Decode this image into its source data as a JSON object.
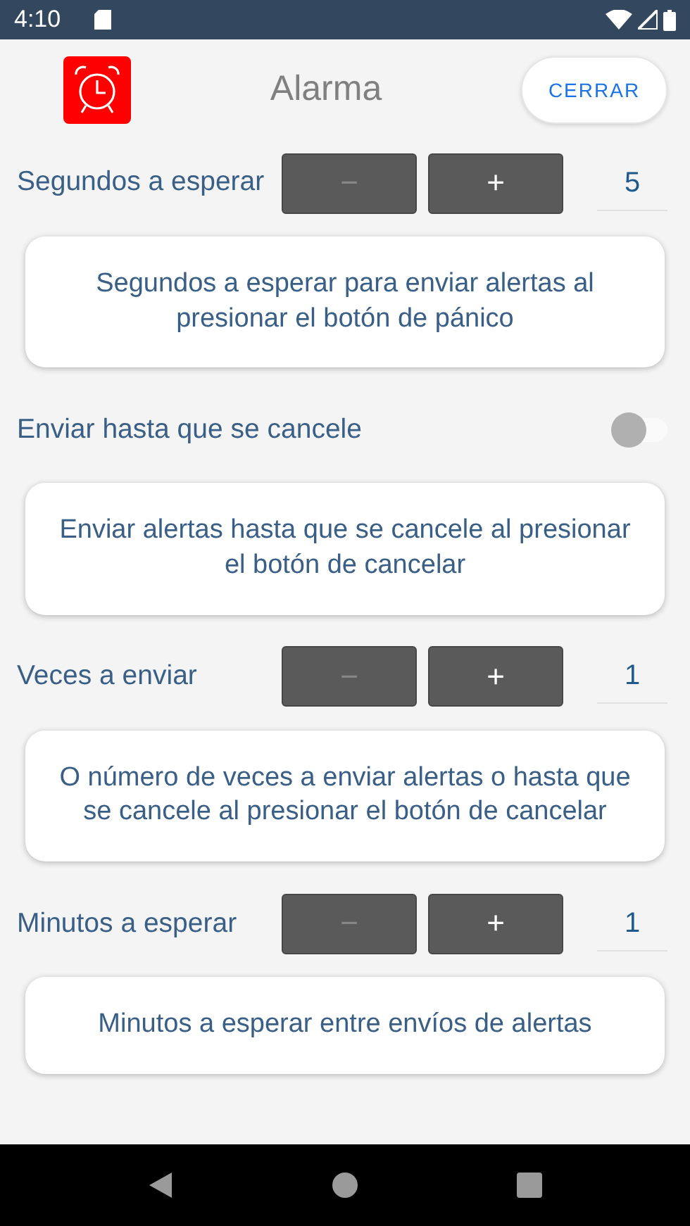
{
  "status_bar": {
    "time": "4:10"
  },
  "header": {
    "title": "Alarma",
    "close_button": "CERRAR"
  },
  "settings": [
    {
      "kind": "stepper",
      "label": "Segundos a esperar",
      "minus": "−",
      "minus_disabled": true,
      "plus": "+",
      "value": "5",
      "description": "Segundos a esperar para enviar alertas al presionar el botón de pánico"
    },
    {
      "kind": "toggle",
      "label": "Enviar hasta que se cancele",
      "on": false,
      "description": "Enviar alertas hasta que se cancele al presionar el botón de cancelar"
    },
    {
      "kind": "stepper",
      "label": "Veces a enviar",
      "minus": "−",
      "minus_disabled": true,
      "plus": "+",
      "value": "1",
      "description": "O número de veces a enviar alertas o hasta que se cancele al presionar el botón de cancelar"
    },
    {
      "kind": "stepper",
      "label": "Minutos a esperar",
      "minus": "−",
      "minus_disabled": true,
      "plus": "+",
      "value": "1",
      "description": "Minutos a esperar entre envíos de alertas"
    }
  ]
}
